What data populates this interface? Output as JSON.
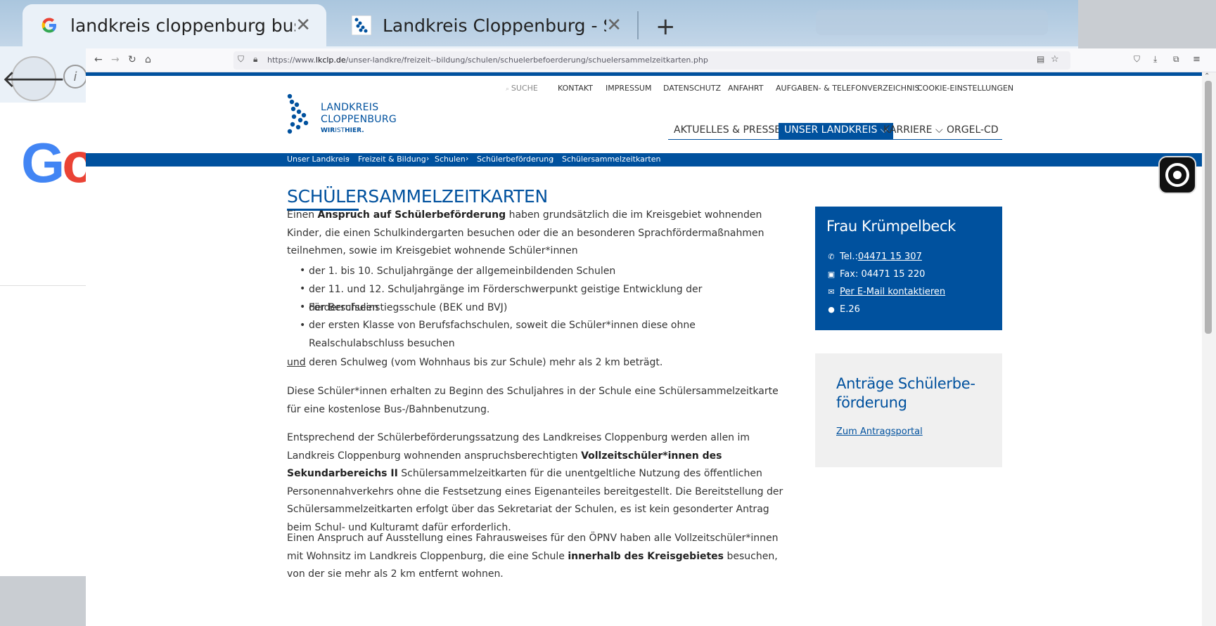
{
  "background_browser": {
    "tabs": [
      {
        "title": "landkreis cloppenburg bus...",
        "favicon": "google-g-icon",
        "active": true
      },
      {
        "title": "Landkreis Cloppenburg - S...",
        "favicon": "lkclp-logo-icon",
        "active": false
      }
    ],
    "new_tab": "+",
    "close_symbol": "✕",
    "google_logo_partial": "G",
    "google_logo_partial2": "o"
  },
  "browser": {
    "url_prefix": "https://www.",
    "url_domain": "lkclp.de",
    "url_path": "/unser-landkre/freizeit--bildung/schulen/schuelerbefoerderung/schuelersammelzeitkarten.php"
  },
  "site": {
    "service_nav": [
      "SUCHE",
      "KONTAKT",
      "IMPRESSUM",
      "DATENSCHUTZ",
      "ANFAHRT",
      "AUFGABEN- & TELEFONVERZEICHNIS",
      "COOKIE-EINSTELLUNGEN"
    ],
    "logo": {
      "line1": "LANDKREIS",
      "line2": "CLOPPENBURG",
      "tagline_a": "WIR",
      "tagline_b": "IST",
      "tagline_c": "HIER."
    },
    "main_nav": [
      {
        "label": "AKTUELLES & PRESSE",
        "active": false
      },
      {
        "label": "UNSER LANDKREIS ⌵",
        "active": true
      },
      {
        "label": "KARRIERE ⌵",
        "active": false
      },
      {
        "label": "ORGEL-CD",
        "active": false
      }
    ],
    "breadcrumb": [
      "Unser Landkreis",
      "Freizeit & Bildung",
      "Schulen",
      "Schülerbeförderung",
      "Schülersammelzeitkarten"
    ]
  },
  "content": {
    "title": "SCHÜLERSAMMELZEITKARTEN",
    "p1_a": "Einen ",
    "p1_b": "Anspruch auf Schülerbeförderung",
    "p1_c": " haben grundsätzlich die im Kreisgebiet wohnenden Kinder, die einen Schulkindergarten besuchen oder die an besonderen Sprachfördermaßnahmen teilnehmen, sowie im Kreisgebiet wohnende Schüler*innen",
    "bullets": [
      "der 1. bis 10. Schuljahrgänge der allgemeinbildenden Schulen",
      "der 11. und 12. Schuljahrgänge im Förderschwerpunkt geistige Entwicklung der Förderschulen",
      "der Berufseinstiegsschule (BEK und BVJ)",
      "der ersten Klasse von Berufsfachschulen, soweit die Schüler*innen diese ohne Realschulabschluss besuchen"
    ],
    "p2_a": "und",
    "p2_b": " deren Schulweg (vom Wohnhaus bis zur Schule) mehr als 2 km beträgt.",
    "p3": "Diese Schüler*innen erhalten zu Beginn des Schuljahres in der Schule eine Schülersammelzeitkarte für eine kostenlose Bus-/Bahnbenutzung.",
    "p4_a": "Entsprechend der Schülerbeförderungssatzung des Landkreises Cloppenburg werden allen im Landkreis Cloppenburg wohnenden anspruchsberechtigten ",
    "p4_b": "Vollzeitschüler*innen des Sekundarbereichs II",
    "p4_c": " Schülersammelzeitkarten für die unentgeltliche Nutzung des öffentlichen Personennahverkehrs ohne die Festsetzung eines Eigenanteiles bereitgestellt. Die Bereitstellung der Schülersammelzeitkarten erfolgt über das Sekretariat der Schulen, es ist kein gesonderter Antrag beim Schul- und Kulturamt dafür erforderlich.",
    "p5_a": "Einen Anspruch auf Ausstellung eines Fahrausweises für den ÖPNV haben alle Vollzeitschüler*innen mit Wohnsitz im Landkreis Cloppenburg, die eine Schule ",
    "p5_b": "innerhalb des Kreisgebietes",
    "p5_c": " besuchen, von der sie mehr als 2 km entfernt wohnen."
  },
  "contact": {
    "name": "Frau Krümpelbeck",
    "tel_label": "Tel.: ",
    "tel": "04471 15 307",
    "fax": "Fax: 04471 15 220",
    "email": "Per E-Mail kontaktieren",
    "room": "E.26"
  },
  "antraege": {
    "title": "Anträge Schülerbe- förderung",
    "link": "Zum Antragsportal"
  },
  "colors": {
    "brand_blue": "#00519e"
  }
}
